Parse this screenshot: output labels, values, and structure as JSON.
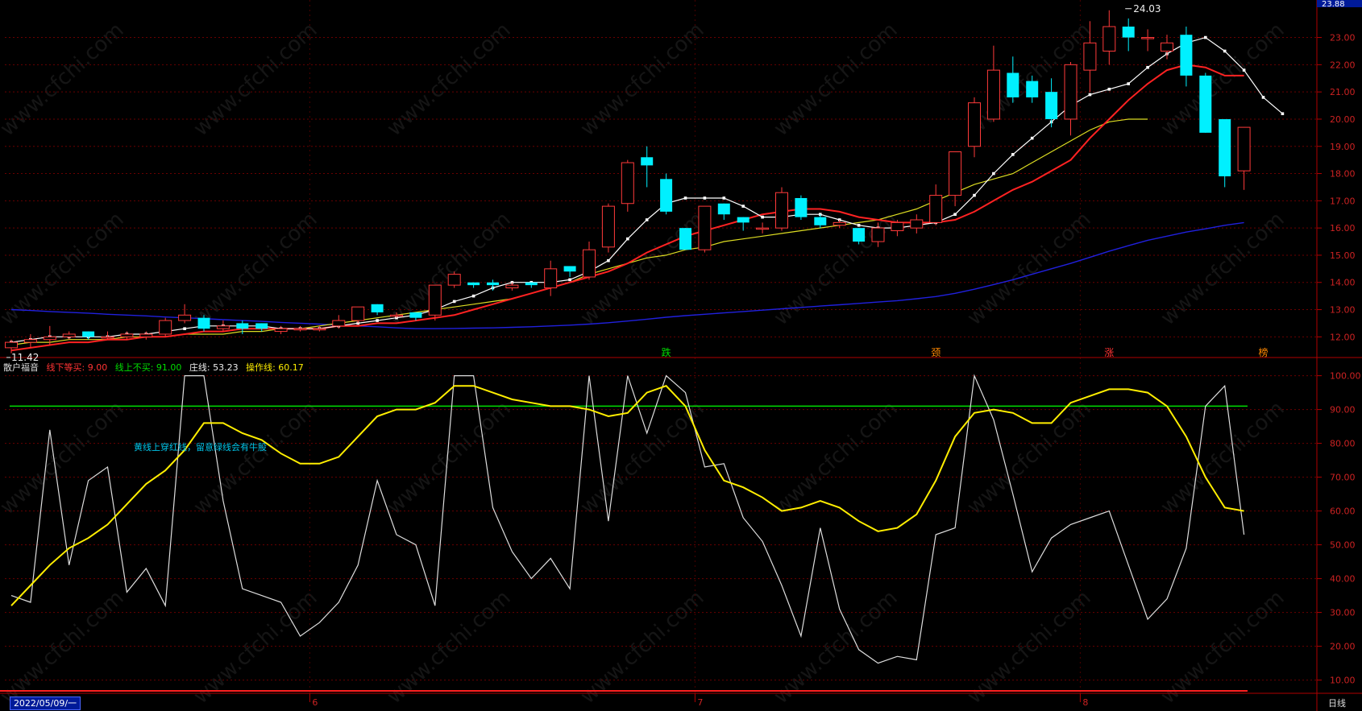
{
  "header": {
    "indicator_name": "散户福音",
    "line_down": "线下等买: 9.00",
    "line_up": "线上不买: 91.00",
    "zhuang": "庄线: 53.23",
    "operate": "操作线: 60.17"
  },
  "note": "黄线上穿红线，留意绿线会有牛股",
  "date_label": "2022/05/09/一",
  "period_label": "日线",
  "watermark": "www.cfchi.com",
  "max_label": "24.03",
  "min_label": "11.42",
  "top_price_label": "23.88",
  "colors": {
    "up": "#ff3a3a",
    "down": "#00f0ff",
    "ma5": "#ffffff",
    "ma10": "#ff2222",
    "ma20": "#dddd22",
    "ma60": "#2020dd",
    "osc_white": "#dddddd",
    "osc_yellow": "#ffee00",
    "green_line": "#00dd00",
    "axis": "#b00000"
  },
  "chart_data": [
    {
      "type": "candlestick",
      "ylim": [
        11.3,
        24.2
      ],
      "y_ticks": [
        "23.00",
        "22.00",
        "21.00",
        "20.00",
        "19.00",
        "18.00",
        "17.00",
        "16.00",
        "15.00",
        "14.00",
        "13.00",
        "12.00"
      ],
      "x_ticks": [
        "6",
        "7",
        "8"
      ],
      "x_tick_index": [
        16,
        36,
        56
      ],
      "candles": [
        {
          "o": 11.6,
          "c": 11.8,
          "h": 11.9,
          "l": 11.4
        },
        {
          "o": 11.8,
          "c": 11.9,
          "h": 12.1,
          "l": 11.6
        },
        {
          "o": 11.9,
          "c": 12.0,
          "h": 12.4,
          "l": 11.7
        },
        {
          "o": 12.0,
          "c": 12.1,
          "h": 12.2,
          "l": 11.9
        },
        {
          "o": 12.2,
          "c": 12.0,
          "h": 12.2,
          "l": 11.9
        },
        {
          "o": 12.0,
          "c": 12.0,
          "h": 12.2,
          "l": 11.9
        },
        {
          "o": 12.0,
          "c": 12.1,
          "h": 12.2,
          "l": 11.9
        },
        {
          "o": 12.0,
          "c": 12.1,
          "h": 12.2,
          "l": 11.9
        },
        {
          "o": 12.1,
          "c": 12.6,
          "h": 12.7,
          "l": 12.0
        },
        {
          "o": 12.6,
          "c": 12.8,
          "h": 13.2,
          "l": 12.5
        },
        {
          "o": 12.7,
          "c": 12.3,
          "h": 12.8,
          "l": 12.2
        },
        {
          "o": 12.3,
          "c": 12.4,
          "h": 12.6,
          "l": 12.2
        },
        {
          "o": 12.5,
          "c": 12.3,
          "h": 12.6,
          "l": 12.1
        },
        {
          "o": 12.5,
          "c": 12.3,
          "h": 12.5,
          "l": 12.2
        },
        {
          "o": 12.2,
          "c": 12.3,
          "h": 12.4,
          "l": 12.1
        },
        {
          "o": 12.3,
          "c": 12.3,
          "h": 12.4,
          "l": 12.2
        },
        {
          "o": 12.3,
          "c": 12.3,
          "h": 12.4,
          "l": 12.2
        },
        {
          "o": 12.4,
          "c": 12.6,
          "h": 12.8,
          "l": 12.3
        },
        {
          "o": 12.6,
          "c": 13.1,
          "h": 13.1,
          "l": 12.5
        },
        {
          "o": 13.2,
          "c": 12.9,
          "h": 13.2,
          "l": 12.8
        },
        {
          "o": 12.8,
          "c": 12.8,
          "h": 12.9,
          "l": 12.7
        },
        {
          "o": 12.9,
          "c": 12.7,
          "h": 12.9,
          "l": 12.6
        },
        {
          "o": 12.8,
          "c": 13.9,
          "h": 13.9,
          "l": 12.6
        },
        {
          "o": 13.9,
          "c": 14.3,
          "h": 14.4,
          "l": 13.8
        },
        {
          "o": 14.0,
          "c": 13.9,
          "h": 14.0,
          "l": 13.8
        },
        {
          "o": 14.0,
          "c": 13.9,
          "h": 14.1,
          "l": 13.7
        },
        {
          "o": 13.8,
          "c": 13.9,
          "h": 14.0,
          "l": 13.7
        },
        {
          "o": 14.0,
          "c": 13.9,
          "h": 14.0,
          "l": 13.8
        },
        {
          "o": 13.8,
          "c": 14.5,
          "h": 14.8,
          "l": 13.5
        },
        {
          "o": 14.6,
          "c": 14.4,
          "h": 14.6,
          "l": 14.2
        },
        {
          "o": 14.2,
          "c": 15.2,
          "h": 15.5,
          "l": 14.1
        },
        {
          "o": 15.3,
          "c": 16.8,
          "h": 16.9,
          "l": 15.1
        },
        {
          "o": 16.9,
          "c": 18.4,
          "h": 18.5,
          "l": 16.6
        },
        {
          "o": 18.6,
          "c": 18.3,
          "h": 19.0,
          "l": 17.5
        },
        {
          "o": 17.8,
          "c": 16.6,
          "h": 18.0,
          "l": 16.5
        },
        {
          "o": 16.0,
          "c": 15.2,
          "h": 16.0,
          "l": 15.2
        },
        {
          "o": 15.2,
          "c": 16.8,
          "h": 16.8,
          "l": 15.1
        },
        {
          "o": 16.9,
          "c": 16.5,
          "h": 16.9,
          "l": 16.3
        },
        {
          "o": 16.4,
          "c": 16.2,
          "h": 16.4,
          "l": 15.9
        },
        {
          "o": 16.0,
          "c": 16.0,
          "h": 16.2,
          "l": 15.8
        },
        {
          "o": 16.0,
          "c": 17.3,
          "h": 17.5,
          "l": 15.9
        },
        {
          "o": 17.1,
          "c": 16.4,
          "h": 17.2,
          "l": 16.3
        },
        {
          "o": 16.4,
          "c": 16.1,
          "h": 16.5,
          "l": 16.0
        },
        {
          "o": 16.1,
          "c": 16.2,
          "h": 16.3,
          "l": 16.0
        },
        {
          "o": 16.0,
          "c": 15.5,
          "h": 16.0,
          "l": 15.4
        },
        {
          "o": 15.5,
          "c": 16.0,
          "h": 16.2,
          "l": 15.3
        },
        {
          "o": 15.9,
          "c": 16.2,
          "h": 16.3,
          "l": 15.7
        },
        {
          "o": 16.0,
          "c": 16.3,
          "h": 16.5,
          "l": 15.8
        },
        {
          "o": 16.2,
          "c": 17.2,
          "h": 17.6,
          "l": 16.1
        },
        {
          "o": 17.2,
          "c": 18.8,
          "h": 18.8,
          "l": 16.8
        },
        {
          "o": 19.0,
          "c": 20.6,
          "h": 20.8,
          "l": 18.6
        },
        {
          "o": 20.0,
          "c": 21.8,
          "h": 22.7,
          "l": 19.9
        },
        {
          "o": 21.7,
          "c": 20.8,
          "h": 22.3,
          "l": 20.6
        },
        {
          "o": 21.4,
          "c": 20.8,
          "h": 21.6,
          "l": 20.6
        },
        {
          "o": 21.0,
          "c": 20.0,
          "h": 21.5,
          "l": 19.7
        },
        {
          "o": 20.0,
          "c": 22.0,
          "h": 22.1,
          "l": 19.4
        },
        {
          "o": 21.8,
          "c": 22.8,
          "h": 23.6,
          "l": 21.0
        },
        {
          "o": 22.5,
          "c": 23.4,
          "h": 24.0,
          "l": 22.0
        },
        {
          "o": 23.4,
          "c": 23.0,
          "h": 23.7,
          "l": 22.5
        },
        {
          "o": 23.0,
          "c": 23.0,
          "h": 23.3,
          "l": 22.5
        },
        {
          "o": 22.5,
          "c": 22.8,
          "h": 23.1,
          "l": 22.2
        },
        {
          "o": 23.1,
          "c": 21.6,
          "h": 23.4,
          "l": 21.2
        },
        {
          "o": 21.6,
          "c": 19.5,
          "h": 21.7,
          "l": 19.5
        },
        {
          "o": 20.0,
          "c": 17.9,
          "h": 20.0,
          "l": 17.5
        },
        {
          "o": 18.1,
          "c": 19.7,
          "h": 19.7,
          "l": 17.4
        }
      ],
      "ma5": [
        11.8,
        11.9,
        12.0,
        12.0,
        12.0,
        12.0,
        12.1,
        12.1,
        12.2,
        12.3,
        12.4,
        12.4,
        12.4,
        12.4,
        12.3,
        12.3,
        12.3,
        12.4,
        12.5,
        12.6,
        12.7,
        12.8,
        13.0,
        13.3,
        13.5,
        13.8,
        14.0,
        14.0,
        14.0,
        14.1,
        14.4,
        14.8,
        15.6,
        16.3,
        16.9,
        17.1,
        17.1,
        17.1,
        16.8,
        16.4,
        16.4,
        16.5,
        16.5,
        16.3,
        16.1,
        16.0,
        16.0,
        16.1,
        16.2,
        16.5,
        17.2,
        18.0,
        18.7,
        19.3,
        19.9,
        20.5,
        20.9,
        21.1,
        21.3,
        21.9,
        22.4,
        22.8,
        23.0,
        22.5,
        21.8,
        20.8,
        20.2
      ],
      "ma10": [
        11.5,
        11.6,
        11.7,
        11.8,
        11.8,
        11.9,
        11.9,
        12.0,
        12.0,
        12.1,
        12.2,
        12.2,
        12.3,
        12.3,
        12.3,
        12.3,
        12.3,
        12.4,
        12.4,
        12.5,
        12.5,
        12.6,
        12.7,
        12.8,
        13.0,
        13.2,
        13.4,
        13.6,
        13.8,
        14.0,
        14.2,
        14.4,
        14.7,
        15.1,
        15.4,
        15.7,
        15.9,
        16.1,
        16.3,
        16.5,
        16.6,
        16.7,
        16.7,
        16.6,
        16.4,
        16.3,
        16.2,
        16.2,
        16.2,
        16.3,
        16.6,
        17.0,
        17.4,
        17.7,
        18.1,
        18.5,
        19.3,
        20.0,
        20.7,
        21.3,
        21.8,
        22.0,
        21.9,
        21.6,
        21.6
      ],
      "ma20": [
        11.7,
        11.8,
        11.8,
        11.9,
        11.9,
        11.9,
        12.0,
        12.0,
        12.0,
        12.1,
        12.1,
        12.1,
        12.2,
        12.2,
        12.3,
        12.3,
        12.4,
        12.5,
        12.6,
        12.7,
        12.8,
        12.9,
        13.0,
        13.1,
        13.2,
        13.3,
        13.4,
        13.6,
        13.8,
        14.0,
        14.3,
        14.5,
        14.7,
        14.9,
        15.0,
        15.2,
        15.3,
        15.5,
        15.6,
        15.7,
        15.8,
        15.9,
        16.0,
        16.1,
        16.2,
        16.3,
        16.5,
        16.7,
        17.0,
        17.3,
        17.6,
        17.8,
        18.0,
        18.4,
        18.8,
        19.2,
        19.6,
        19.9,
        20.0,
        20.0
      ],
      "ma60": [
        13.0,
        12.97,
        12.93,
        12.9,
        12.87,
        12.83,
        12.8,
        12.77,
        12.73,
        12.7,
        12.67,
        12.63,
        12.6,
        12.57,
        12.53,
        12.5,
        12.47,
        12.43,
        12.4,
        12.37,
        12.33,
        12.3,
        12.3,
        12.31,
        12.32,
        12.33,
        12.35,
        12.37,
        12.4,
        12.43,
        12.47,
        12.52,
        12.58,
        12.65,
        12.72,
        12.78,
        12.83,
        12.88,
        12.93,
        12.98,
        13.03,
        13.08,
        13.13,
        13.18,
        13.23,
        13.28,
        13.33,
        13.4,
        13.48,
        13.6,
        13.75,
        13.92,
        14.1,
        14.3,
        14.5,
        14.7,
        14.92,
        15.15,
        15.35,
        15.55,
        15.7,
        15.85,
        15.97,
        16.1,
        16.2
      ]
    },
    {
      "type": "line",
      "ylim": [
        8,
        103
      ],
      "y_ticks": [
        "100.00",
        "90.00",
        "80.00",
        "70.00",
        "60.00",
        "50.00",
        "40.00",
        "30.00",
        "20.00",
        "10.00"
      ],
      "series": [
        {
          "name": "线下等买",
          "values": [
            9,
            9,
            9,
            9,
            9,
            9,
            9,
            9,
            9,
            9,
            9,
            9,
            9,
            9,
            9,
            9,
            9,
            9,
            9,
            9,
            9,
            9,
            9,
            9,
            9,
            9,
            9,
            9,
            9,
            9,
            9,
            9,
            9,
            9,
            9,
            9,
            9,
            9,
            9,
            9,
            9,
            9,
            9,
            9,
            9,
            9,
            9,
            9,
            9,
            9,
            9,
            9,
            9,
            9,
            9,
            9,
            9,
            9,
            9,
            9,
            9,
            9,
            9,
            9,
            9,
            9
          ]
        },
        {
          "name": "线上不买",
          "values": [
            91,
            91,
            91,
            91,
            91,
            91,
            91,
            91,
            91,
            91,
            91,
            91,
            91,
            91,
            91,
            91,
            91,
            91,
            91,
            91,
            91,
            91,
            91,
            91,
            91,
            91,
            91,
            91,
            91,
            91,
            91,
            91,
            91,
            91,
            91,
            91,
            91,
            91,
            91,
            91,
            91,
            91,
            91,
            91,
            91,
            91,
            91,
            91,
            91,
            91,
            91,
            91,
            91,
            91,
            91,
            91,
            91,
            91,
            91,
            91,
            91,
            91,
            91,
            91,
            91,
            91
          ]
        },
        {
          "name": "庄线",
          "values": [
            35,
            33,
            84,
            44,
            69,
            73,
            36,
            43,
            32,
            100,
            100,
            63,
            37,
            35,
            33,
            23,
            27,
            33,
            44,
            69,
            53,
            50,
            32,
            100,
            100,
            61,
            48,
            40,
            46,
            37,
            100,
            57,
            100,
            83,
            100,
            95,
            73,
            74,
            58,
            51,
            38,
            23,
            55,
            31,
            19,
            15,
            17,
            16,
            53,
            55,
            100,
            87,
            65,
            42,
            52,
            56,
            58,
            60,
            44,
            28,
            34,
            49,
            91,
            97,
            53
          ]
        },
        {
          "name": "操作线",
          "values": [
            32,
            38,
            44,
            49,
            52,
            56,
            62,
            68,
            72,
            78,
            86,
            86,
            83,
            81,
            77,
            74,
            74,
            76,
            82,
            88,
            90,
            90,
            92,
            97,
            97,
            95,
            93,
            92,
            91,
            91,
            90,
            88,
            89,
            95,
            97,
            91,
            78,
            69,
            67,
            64,
            60,
            61,
            63,
            61,
            57,
            54,
            55,
            59,
            69,
            82,
            89,
            90,
            89,
            86,
            86,
            92,
            94,
            96,
            96,
            95,
            91,
            82,
            70,
            61,
            60
          ]
        }
      ]
    }
  ]
}
